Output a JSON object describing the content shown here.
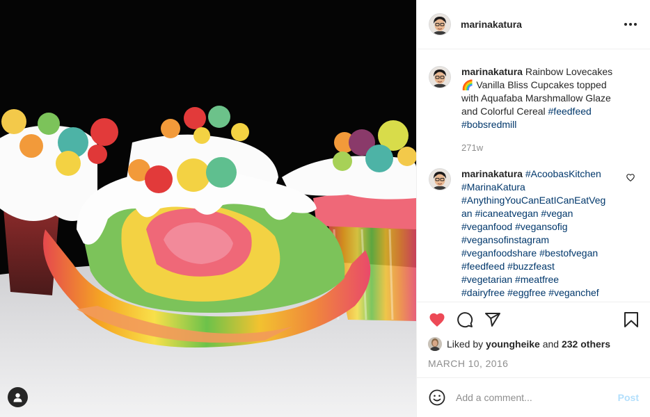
{
  "post": {
    "username": "marinakatura",
    "more_icon": "more-horizontal-icon"
  },
  "caption": {
    "username": "marinakatura",
    "text": "Rainbow Lovecakes 🌈 Vanilla Bliss Cupcakes topped with Aquafaba Marshmallow Glaze and Colorful Cereal",
    "hashtags": [
      "#feedfeed",
      "#bobsredmill"
    ],
    "time": "271w"
  },
  "comment": {
    "username": "marinakatura",
    "lines": [
      "#AcoobasKitchen",
      "#MarinaKatura",
      "#AnythingYouCanEatICanEatVeg",
      "an #icaneatvegan #vegan",
      "#veganfood #vegansofig",
      "#vegansofinstagram",
      "#veganfoodshare #bestofvegan",
      "#feedfeed #buzzfeast",
      "#vegetarian #meatfree",
      "#dairyfree #eggfree #veganchef"
    ]
  },
  "likes": {
    "prefix": "Liked by",
    "user": "youngheike",
    "joiner": "and",
    "others": "232 others"
  },
  "date": "MARCH 10, 2016",
  "add_comment": {
    "placeholder": "Add a comment...",
    "post_label": "Post"
  },
  "colors": {
    "liked_heart": "#ed4956",
    "hashtag": "#00376b",
    "post_button_disabled": "#b2dffc",
    "secondary_text": "#8e8e8e"
  },
  "icons": [
    "heart-filled-icon",
    "comment-icon",
    "share-icon",
    "bookmark-icon",
    "emoji-icon",
    "user-tag-icon",
    "heart-outline-icon"
  ]
}
